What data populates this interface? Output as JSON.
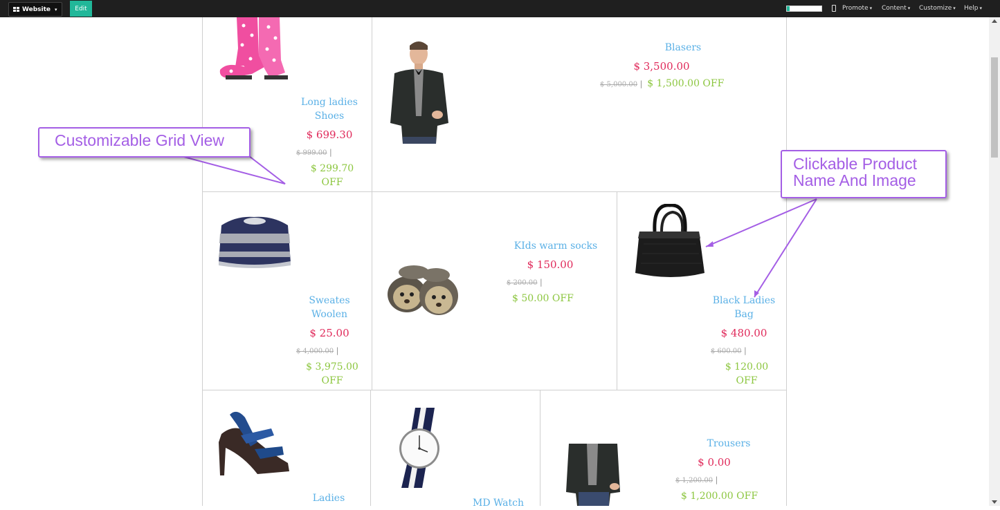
{
  "topbar": {
    "website_label": "Website",
    "edit_label": "Edit",
    "menus": [
      "Promote",
      "Content",
      "Customize",
      "Help"
    ],
    "accent": "#21b799"
  },
  "products": [
    {
      "name_line1": "Long ladies",
      "name_line2": "Shoes",
      "price": "$ 699.30",
      "old_price": "$ 999.00",
      "save": "$ 299.70",
      "save_suffix": "OFF",
      "image": "pink-rain-boots"
    },
    {
      "name_line1": "Blasers",
      "name_line2": "",
      "price": "$ 3,500.00",
      "old_price": "$ 5,000.00",
      "save": "$ 1,500.00 OFF",
      "save_suffix": "",
      "image": "man-in-blazer"
    },
    {
      "name_line1": "Sweates",
      "name_line2": "Woolen",
      "price": "$ 25.00",
      "old_price": "$ 4,000.00",
      "save": "$ 3,975.00",
      "save_suffix": "OFF",
      "image": "striped-sweater"
    },
    {
      "name_line1": "KIds warm socks",
      "name_line2": "",
      "price": "$ 150.00",
      "old_price": "$ 200.00",
      "save": "$ 50.00 OFF",
      "save_suffix": "",
      "image": "kids-booties"
    },
    {
      "name_line1": "Black Ladies",
      "name_line2": "Bag",
      "price": "$ 480.00",
      "old_price": "$ 600.00",
      "save": "$ 120.00",
      "save_suffix": "OFF",
      "image": "black-handbag"
    },
    {
      "name_line1": "Ladies",
      "name_line2": "",
      "image": "blue-high-heels"
    },
    {
      "name_line1": "MD Watch",
      "name_line2": "",
      "image": "striped-strap-watch"
    },
    {
      "name_line1": "Trousers",
      "name_line2": "",
      "price": "$ 0.00",
      "old_price": "$ 1,200.00",
      "save": "$ 1,200.00 OFF",
      "save_suffix": "",
      "image": "man-in-jacket-jeans"
    }
  ],
  "callouts": {
    "grid": "Customizable Grid View",
    "clickable_line1": "Clickable Product",
    "clickable_line2": "Name And Image",
    "color": "#a45ee5"
  },
  "colors": {
    "name": "#5ab0e6",
    "price": "#e0295a",
    "save": "#8cc63f"
  }
}
